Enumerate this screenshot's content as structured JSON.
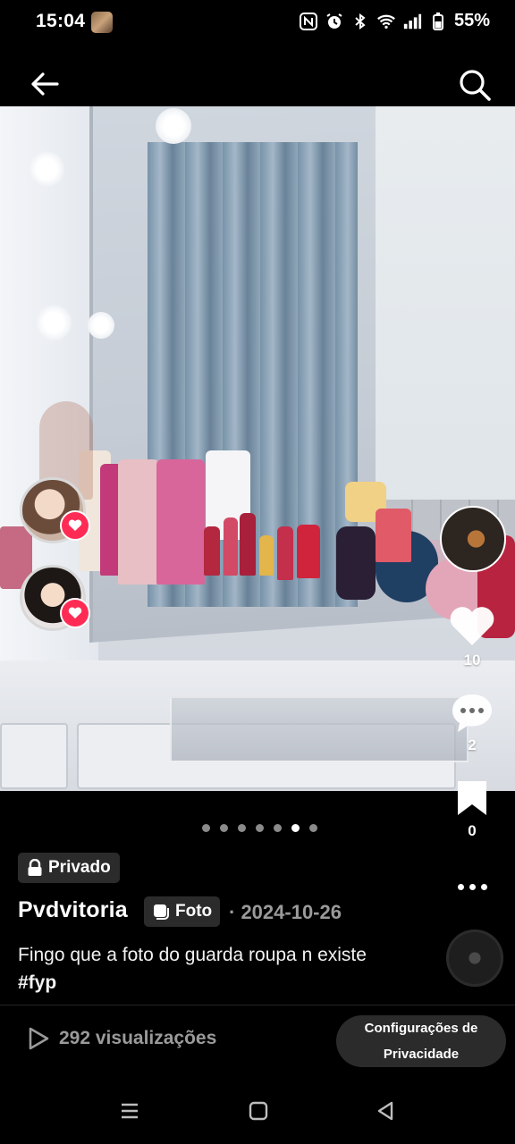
{
  "status_bar": {
    "time": "15:04",
    "battery": "55%",
    "icons": [
      "nfc-icon",
      "alarm-icon",
      "bluetooth-icon",
      "wifi-icon",
      "signal-icon",
      "battery-icon"
    ]
  },
  "top_nav": {
    "back_icon": "arrow-left-icon",
    "search_icon": "search-icon"
  },
  "side_actions": {
    "likes": "10",
    "comments": "2",
    "saves": "0"
  },
  "carousel": {
    "total": 7,
    "active_index": 5
  },
  "post": {
    "privacy_label": "Privado",
    "username": "Pvdvitoria",
    "type_label": "Foto",
    "date": "· 2024-10-26",
    "caption_text": "Fingo que a foto do guarda roupa n existe ",
    "caption_tag": "#fyp"
  },
  "footer": {
    "views": "292 visualizações",
    "settings_line1": "Configurações de",
    "settings_line2": "Privacidade"
  },
  "colors": {
    "accent": "#fe2c55",
    "background": "#000000",
    "badge": "#2b2b2b",
    "muted": "#9a9a9a"
  }
}
